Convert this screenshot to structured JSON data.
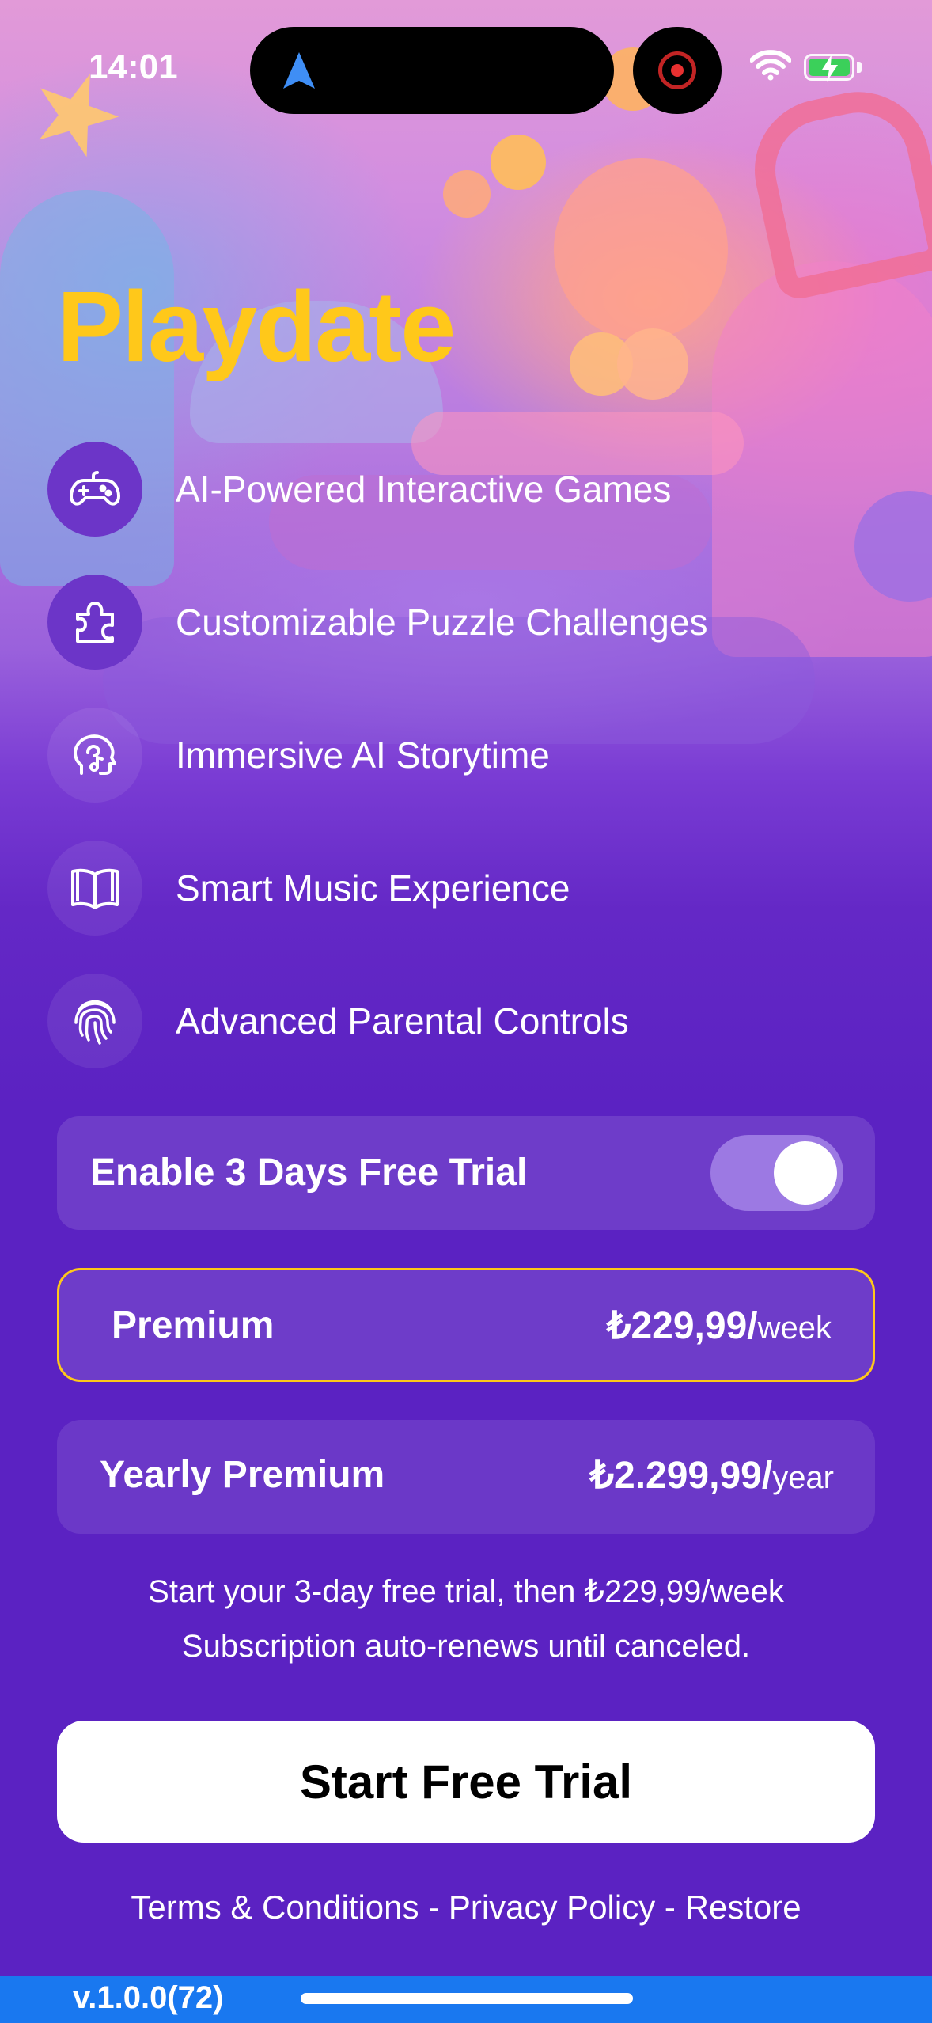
{
  "status_bar": {
    "time": "14:01"
  },
  "app": {
    "title": "Playdate",
    "accent_color": "#ffc81a",
    "background_color": "#5b22c2"
  },
  "features": [
    {
      "label": "AI-Powered Interactive Games",
      "icon": "gamepad-icon"
    },
    {
      "label": "Customizable Puzzle Challenges",
      "icon": "puzzle-icon"
    },
    {
      "label": "Immersive AI Storytime",
      "icon": "head-music-icon"
    },
    {
      "label": "Smart Music Experience",
      "icon": "book-icon"
    },
    {
      "label": "Advanced Parental Controls",
      "icon": "fingerprint-icon"
    }
  ],
  "trial": {
    "label": "Enable 3 Days Free Trial",
    "enabled": true
  },
  "plans": [
    {
      "name": "Premium",
      "price": "₺229,99/",
      "period": "week",
      "selected": true
    },
    {
      "name": "Yearly Premium",
      "price": "₺2.299,99/",
      "period": "year",
      "selected": false
    }
  ],
  "legal": {
    "line1": "Start your 3-day free trial, then ₺229,99/week",
    "line2": "Subscription auto-renews until canceled."
  },
  "cta": {
    "label": "Start Free Trial"
  },
  "links": {
    "terms": "Terms & Conditions",
    "privacy": "Privacy Policy",
    "restore": "Restore",
    "separator": " - "
  },
  "footer": {
    "version": "v.1.0.0(72)"
  }
}
